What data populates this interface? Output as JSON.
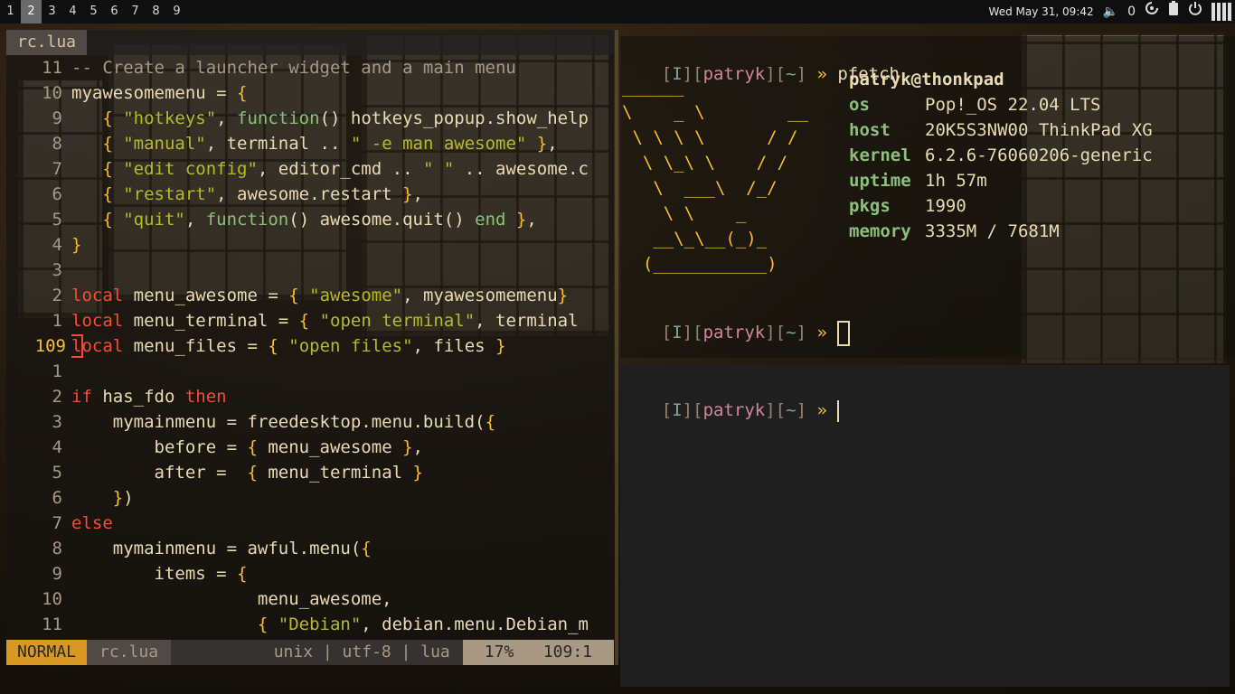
{
  "topbar": {
    "tags": [
      "1",
      "2",
      "3",
      "4",
      "5",
      "6",
      "7",
      "8",
      "9"
    ],
    "active_tag_index": 1,
    "clock": "Wed May 31, 09:42",
    "volume_level": "0",
    "icons": [
      "volume-icon",
      "network-icon",
      "battery-icon",
      "power-icon",
      "layout-icon"
    ]
  },
  "editor": {
    "tab_label": "rc.lua",
    "lines": [
      {
        "n": "11",
        "t": [
          [
            "c-com",
            "-- Create a launcher widget and a main menu"
          ]
        ]
      },
      {
        "n": "10",
        "t": [
          [
            "c-id",
            "myawesomemenu = "
          ],
          [
            "c-br",
            "{"
          ]
        ]
      },
      {
        "n": "9",
        "t": [
          [
            "c-br",
            "   { "
          ],
          [
            "c-str",
            "\"hotkeys\""
          ],
          [
            "c-id",
            ", "
          ],
          [
            "c-fn",
            "function"
          ],
          [
            "c-id",
            "() hotkeys_popup.show_help"
          ]
        ]
      },
      {
        "n": "8",
        "t": [
          [
            "c-br",
            "   { "
          ],
          [
            "c-str",
            "\"manual\""
          ],
          [
            "c-id",
            ", terminal .. "
          ],
          [
            "c-str",
            "\" -e man awesome\""
          ],
          [
            "c-br",
            " }"
          ],
          [
            "c-id",
            ","
          ]
        ]
      },
      {
        "n": "7",
        "t": [
          [
            "c-br",
            "   { "
          ],
          [
            "c-str",
            "\"edit config\""
          ],
          [
            "c-id",
            ", editor_cmd .. "
          ],
          [
            "c-str",
            "\" \""
          ],
          [
            "c-id",
            " .. awesome.c"
          ]
        ]
      },
      {
        "n": "6",
        "t": [
          [
            "c-br",
            "   { "
          ],
          [
            "c-str",
            "\"restart\""
          ],
          [
            "c-id",
            ", awesome.restart "
          ],
          [
            "c-br",
            "}"
          ],
          [
            "c-id",
            ","
          ]
        ]
      },
      {
        "n": "5",
        "t": [
          [
            "c-br",
            "   { "
          ],
          [
            "c-str",
            "\"quit\""
          ],
          [
            "c-id",
            ", "
          ],
          [
            "c-fn",
            "function"
          ],
          [
            "c-id",
            "() awesome.quit() "
          ],
          [
            "c-fn",
            "end"
          ],
          [
            "c-br",
            " }"
          ],
          [
            "c-id",
            ","
          ]
        ]
      },
      {
        "n": "4",
        "t": [
          [
            "c-br",
            "}"
          ]
        ]
      },
      {
        "n": "3",
        "t": []
      },
      {
        "n": "2",
        "t": [
          [
            "c-kw",
            "local"
          ],
          [
            "c-id",
            " menu_awesome = "
          ],
          [
            "c-br",
            "{ "
          ],
          [
            "c-str",
            "\"awesome\""
          ],
          [
            "c-id",
            ", myawesomemenu"
          ],
          [
            "c-br",
            "}"
          ]
        ]
      },
      {
        "n": "1",
        "t": [
          [
            "c-kw",
            "local"
          ],
          [
            "c-id",
            " menu_terminal = "
          ],
          [
            "c-br",
            "{ "
          ],
          [
            "c-str",
            "\"open terminal\""
          ],
          [
            "c-id",
            ", terminal"
          ]
        ]
      },
      {
        "n": "109",
        "cur": true,
        "t": [
          [
            "c-kw",
            "local"
          ],
          [
            "c-id",
            " menu_files = "
          ],
          [
            "c-br",
            "{ "
          ],
          [
            "c-str",
            "\"open files\""
          ],
          [
            "c-id",
            ", files "
          ],
          [
            "c-br",
            "}"
          ]
        ]
      },
      {
        "n": "1",
        "t": []
      },
      {
        "n": "2",
        "t": [
          [
            "c-kw",
            "if"
          ],
          [
            "c-id",
            " has_fdo "
          ],
          [
            "c-kw",
            "then"
          ]
        ]
      },
      {
        "n": "3",
        "t": [
          [
            "c-id",
            "    mymainmenu = freedesktop.menu.build("
          ],
          [
            "c-br",
            "{"
          ]
        ]
      },
      {
        "n": "4",
        "t": [
          [
            "c-id",
            "        before = "
          ],
          [
            "c-br",
            "{ "
          ],
          [
            "c-id",
            "menu_awesome "
          ],
          [
            "c-br",
            "}"
          ],
          [
            "c-id",
            ","
          ]
        ]
      },
      {
        "n": "5",
        "t": [
          [
            "c-id",
            "        after =  "
          ],
          [
            "c-br",
            "{ "
          ],
          [
            "c-id",
            "menu_terminal "
          ],
          [
            "c-br",
            "}"
          ]
        ]
      },
      {
        "n": "6",
        "t": [
          [
            "c-br",
            "    }"
          ],
          [
            "c-id",
            ")"
          ]
        ]
      },
      {
        "n": "7",
        "t": [
          [
            "c-kw",
            "else"
          ]
        ]
      },
      {
        "n": "8",
        "t": [
          [
            "c-id",
            "    mymainmenu = awful.menu("
          ],
          [
            "c-br",
            "{"
          ]
        ]
      },
      {
        "n": "9",
        "t": [
          [
            "c-id",
            "        items = "
          ],
          [
            "c-br",
            "{"
          ]
        ]
      },
      {
        "n": "10",
        "t": [
          [
            "c-id",
            "                  menu_awesome,"
          ]
        ]
      },
      {
        "n": "11",
        "t": [
          [
            "c-br",
            "                  { "
          ],
          [
            "c-str",
            "\"Debian\""
          ],
          [
            "c-id",
            ", debian.menu.Debian_m"
          ]
        ]
      }
    ],
    "status": {
      "mode": "NORMAL",
      "file": "rc.lua",
      "info": "unix | utf-8 | lua",
      "percent": "17%",
      "position": "109:1"
    }
  },
  "term_top": {
    "prompt": {
      "open1": "[",
      "i": "I",
      "close1": "]",
      "open2": "[",
      "user": "patryk",
      "close2": "]",
      "open3": "[",
      "dir": "~",
      "close3": "]",
      "arrow": " » "
    },
    "command": "pfetch",
    "ascii": "______\n\\    _ \\        __\n \\ \\ \\ \\      / /\n  \\ \\_\\ \\    / /\n   \\  ___\\  /_/\n    \\ \\    _\n   __\\_\\__(_)_\n  (___________)",
    "title": "patryk@thonkpad",
    "info": [
      {
        "k": "os",
        "v": "Pop!_OS 22.04 LTS"
      },
      {
        "k": "host",
        "v": "20K5S3NW00 ThinkPad XG"
      },
      {
        "k": "kernel",
        "v": "6.2.6-76060206-generic"
      },
      {
        "k": "uptime",
        "v": "1h 57m"
      },
      {
        "k": "pkgs",
        "v": "1990"
      },
      {
        "k": "memory",
        "v": "3335M / 7681M"
      }
    ]
  },
  "term_bottom": {
    "prompt": {
      "open1": "[",
      "i": "I",
      "close1": "]",
      "open2": "[",
      "user": "patryk",
      "close2": "]",
      "open3": "[",
      "dir": "~",
      "close3": "]",
      "arrow": " » "
    }
  }
}
